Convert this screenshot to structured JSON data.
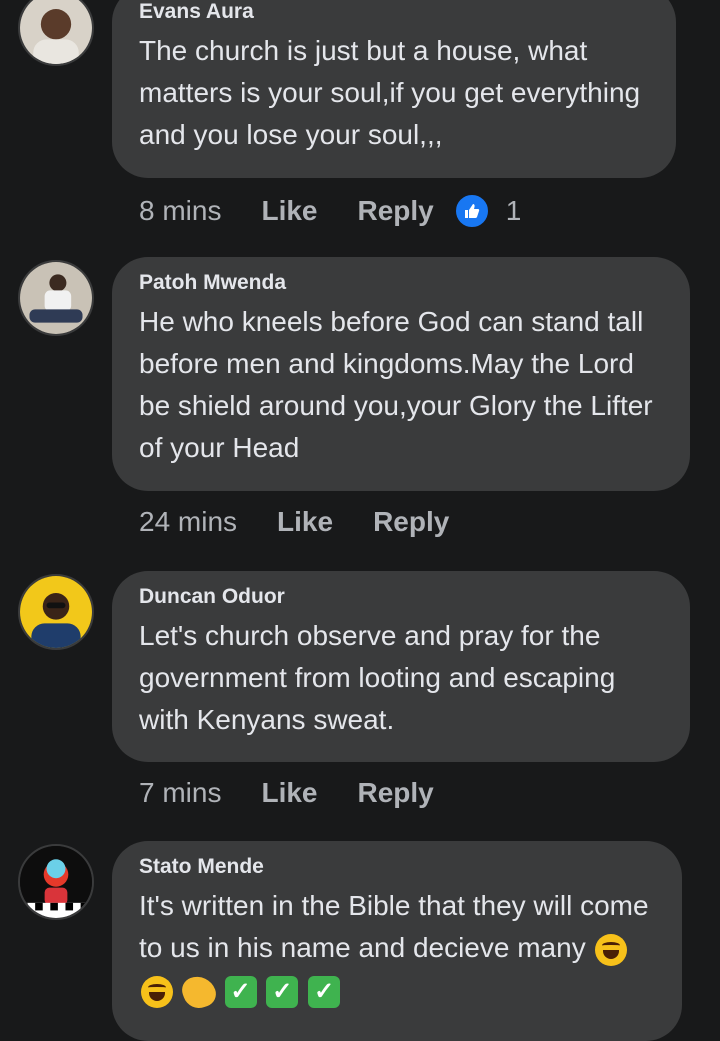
{
  "comments": [
    {
      "author": "Evans Aura",
      "text": "The church is just but a house, what matters is your soul,if you get everything and you lose your soul,,,",
      "time": "8 mins",
      "like_label": "Like",
      "reply_label": "Reply",
      "reaction_count": "1"
    },
    {
      "author": "Patoh Mwenda",
      "text": "He who kneels before God can stand tall before men and kingdoms.May the Lord be shield around you,your Glory the Lifter of your Head",
      "time": "24 mins",
      "like_label": "Like",
      "reply_label": "Reply"
    },
    {
      "author": "Duncan Oduor",
      "text": "Let's church observe and pray for the government from looting and escaping with Kenyans sweat.",
      "time": "7 mins",
      "like_label": "Like",
      "reply_label": "Reply"
    },
    {
      "author": "Stato Mende",
      "text": "It's written in the Bible that they will come to us in his name and decieve many",
      "emojis": [
        "laughing-crying",
        "laughing-crying",
        "clapping-hands",
        "check-mark",
        "check-mark",
        "check-mark"
      ]
    }
  ],
  "colors": {
    "background": "#18191a",
    "bubble": "#3a3b3c",
    "text": "#e4e6eb",
    "secondary_text": "#b0b3b8",
    "like_blue": "#1877f2"
  }
}
